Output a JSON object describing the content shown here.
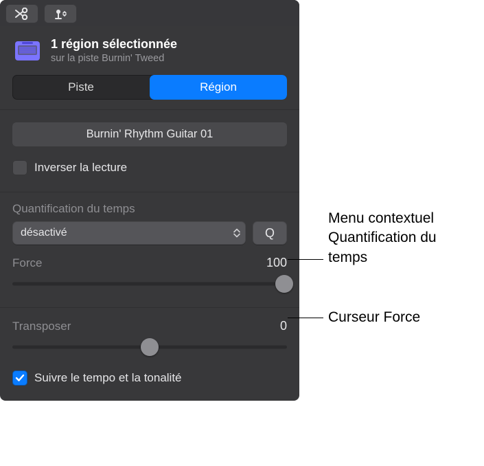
{
  "header": {
    "title": "1 région sélectionnée",
    "subtitle": "sur la piste Burnin' Tweed"
  },
  "segment": {
    "piste": "Piste",
    "region": "Région"
  },
  "region": {
    "name": "Burnin' Rhythm Guitar 01"
  },
  "reverse": {
    "label": "Inverser la lecture",
    "checked": false
  },
  "quantize": {
    "label": "Quantification du temps",
    "value": "désactivé",
    "q_button": "Q"
  },
  "force": {
    "label": "Force",
    "value": "100",
    "slider_pct": 100
  },
  "transpose": {
    "label": "Transposer",
    "value": "0",
    "slider_pct": 50
  },
  "follow": {
    "label": "Suivre le tempo et la tonalité",
    "checked": true
  },
  "annotations": {
    "quant_menu": "Menu contextuel Quantification du temps",
    "force_slider": "Curseur Force"
  }
}
